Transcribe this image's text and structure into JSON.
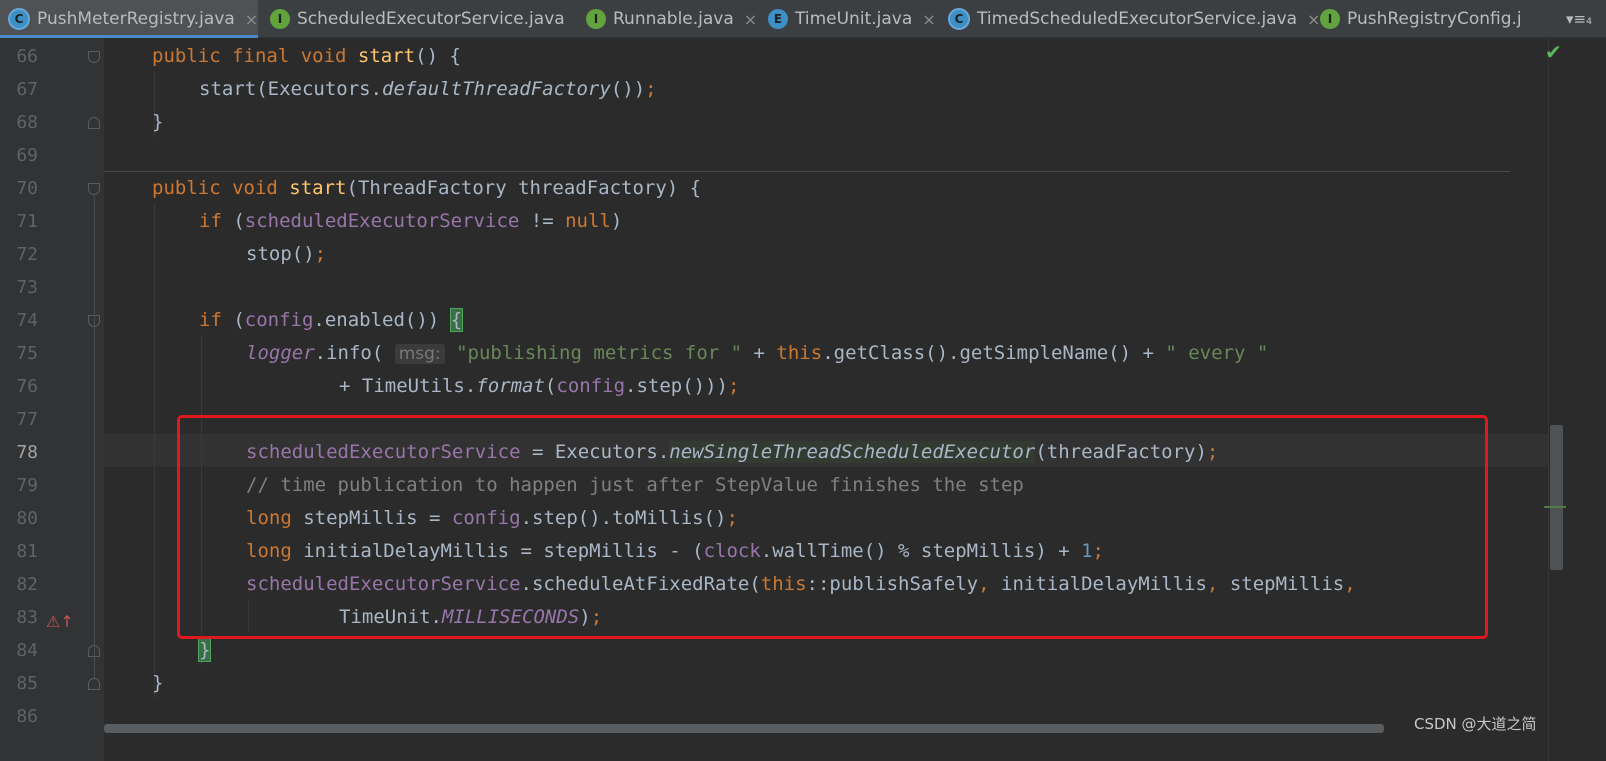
{
  "tabs": [
    {
      "icon": "C",
      "icon_type": "class",
      "label": "PushMeterRegistry.java",
      "active": true
    },
    {
      "icon": "I",
      "icon_type": "interface",
      "label": "ScheduledExecutorService.java",
      "active": false
    },
    {
      "icon": "I",
      "icon_type": "interface",
      "label": "Runnable.java",
      "active": false
    },
    {
      "icon": "E",
      "icon_type": "enum",
      "label": "TimeUnit.java",
      "active": false
    },
    {
      "icon": "C",
      "icon_type": "class",
      "label": "TimedScheduledExecutorService.java",
      "active": false
    },
    {
      "icon": "I",
      "icon_type": "interface",
      "label": "PushRegistryConfig.j",
      "active": false
    }
  ],
  "tab_close_glyph": "×",
  "tab_overflow": "▾≡₄",
  "line_numbers": [
    "66",
    "67",
    "68",
    "69",
    "70",
    "71",
    "72",
    "73",
    "74",
    "75",
    "76",
    "77",
    "78",
    "79",
    "80",
    "81",
    "82",
    "83",
    "84",
    "85",
    "86"
  ],
  "current_line": "78",
  "code": {
    "l66": {
      "mod": "public final void",
      "name": "start",
      "rest": "() {"
    },
    "l67": {
      "a": "start(Executors.",
      "b": "defaultThreadFactory",
      "c": "())",
      "d": ";"
    },
    "l68": {
      "a": "}"
    },
    "l70": {
      "mod": "public void",
      "name": "start",
      "rest": "(ThreadFactory threadFactory) {"
    },
    "l71": {
      "kw": "if",
      "a": " (",
      "fld": "scheduledExecutorService",
      "b": " != ",
      "kw2": "null",
      "c": ")"
    },
    "l72": {
      "a": "stop()",
      "semi": ";"
    },
    "l74": {
      "kw": "if",
      "a": " (",
      "fld": "config",
      "b": ".enabled()) ",
      "brace": "{"
    },
    "l75": {
      "logger": "logger",
      "a": ".info( ",
      "hint": "msg:",
      "s1": "\"publishing metrics for \"",
      "b": " + ",
      "kw": "this",
      "c": ".getClass().getSimpleName() + ",
      "s2": "\" every \""
    },
    "l76": {
      "a": "+ TimeUtils.",
      "fmt": "format",
      "b": "(",
      "fld": "config",
      "c": ".step()))",
      "semi": ";"
    },
    "l78": {
      "fld": "scheduledExecutorService",
      "a": " = Executors.",
      "m": "newSingleThreadScheduledExecutor",
      "b": "(threadFactory)",
      "semi": ";"
    },
    "l79": {
      "cmt": "// time publication to happen just after StepValue finishes the step"
    },
    "l80": {
      "kw": "long",
      "a": " stepMillis = ",
      "fld": "config",
      "b": ".step().toMillis()",
      "semi": ";"
    },
    "l81": {
      "kw": "long",
      "a": " initialDelayMillis = stepMillis - (",
      "fld": "clock",
      "b": ".wallTime() % stepMillis) + ",
      "num": "1",
      "semi": ";"
    },
    "l82": {
      "fld": "scheduledExecutorService",
      "a": ".scheduleAtFixedRate(",
      "kw": "this",
      "b": "::publishSafely",
      "c1": ",",
      "d": " initialDelayMillis",
      "c2": ",",
      "e": " stepMillis",
      "c3": ","
    },
    "l83": {
      "a": "TimeUnit.",
      "sf": "MILLISECONDS",
      "b": ")",
      "semi": ";"
    },
    "l84": {
      "brace": "}"
    },
    "l85": {
      "a": "}"
    }
  },
  "gutter_override_icon": "⚠↑",
  "inspection_status": "✔",
  "watermark": "CSDN @大道之简",
  "colors": {
    "keyword": "#cc7832",
    "method_decl": "#ffc66d",
    "field": "#9876aa",
    "string": "#6a8759",
    "comment": "#808080",
    "number": "#6897bb",
    "highlight_box": "#e0191e"
  }
}
